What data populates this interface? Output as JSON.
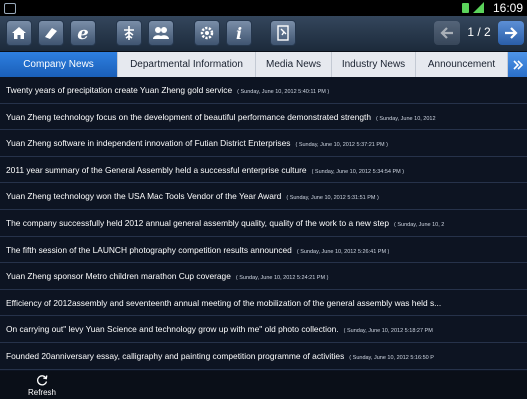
{
  "statusbar": {
    "time": "16:09"
  },
  "toolbar": {
    "buttons": [
      {
        "name": "home-icon"
      },
      {
        "name": "bookmark-icon"
      },
      {
        "name": "browser-e-icon",
        "glyph": "e"
      },
      {
        "name": "logo-icon"
      },
      {
        "name": "people-icon"
      },
      {
        "name": "gear-icon"
      },
      {
        "name": "info-icon",
        "glyph": "i"
      },
      {
        "name": "exit-icon"
      }
    ],
    "pager": {
      "page": "1 / 2"
    }
  },
  "tabs": {
    "items": [
      {
        "label": "Company News",
        "active": true
      },
      {
        "label": "Departmental Information",
        "active": false
      },
      {
        "label": "Media News",
        "active": false
      },
      {
        "label": "Industry News",
        "active": false
      },
      {
        "label": "Announcement",
        "active": false
      }
    ],
    "more_icon": "double-chevron-right-icon"
  },
  "news": {
    "items": [
      {
        "title": "Twenty years of precipitation create Yuan Zheng gold service",
        "date": "( Sunday, June 10, 2012 5:40:11 PM )"
      },
      {
        "title": "Yuan Zheng technology focus on the development of beautiful performance demonstrated strength",
        "date": "( Sunday, June 10, 2012"
      },
      {
        "title": "Yuan Zheng software in independent innovation of Futian District Enterprises",
        "date": "( Sunday, June 10, 2012 5:37:21 PM )"
      },
      {
        "title": "2011 year summary of the General Assembly held a successful enterprise culture",
        "date": "( Sunday, June 10, 2012 5:34:54 PM )"
      },
      {
        "title": "Yuan Zheng technology won the USA Mac Tools Vendor of the Year Award",
        "date": "( Sunday, June 10, 2012 5:31:51 PM )"
      },
      {
        "title": "The company successfully held 2012 annual general assembly quality, quality of the work to a new step",
        "date": "( Sunday, June 10, 2"
      },
      {
        "title": "The fifth session of the LAUNCH photography competition results announced",
        "date": "( Sunday, June 10, 2012 5:26:41 PM )"
      },
      {
        "title": "Yuan Zheng sponsor Metro children marathon Cup coverage",
        "date": "( Sunday, June 10, 2012 5:24:21 PM )"
      },
      {
        "title": "Efficiency of 2012assembly and seventeenth annual meeting of the mobilization of the general assembly was held s...",
        "date": ""
      },
      {
        "title": "On carrying out\" levy Yuan Science and technology grow up with me\" old photo collection.",
        "date": "( Sunday, June 10, 2012 5:18:27 PM"
      },
      {
        "title": "Founded 20anniversary essay, calligraphy and painting competition programme of activities",
        "date": "( Sunday, June 10, 2012 5:16:50 P"
      }
    ]
  },
  "bottombar": {
    "refresh_label": "Refresh"
  },
  "colors": {
    "tab_active": "#1f6fd0",
    "background": "#0d1422",
    "accent": "#5bd35b"
  }
}
